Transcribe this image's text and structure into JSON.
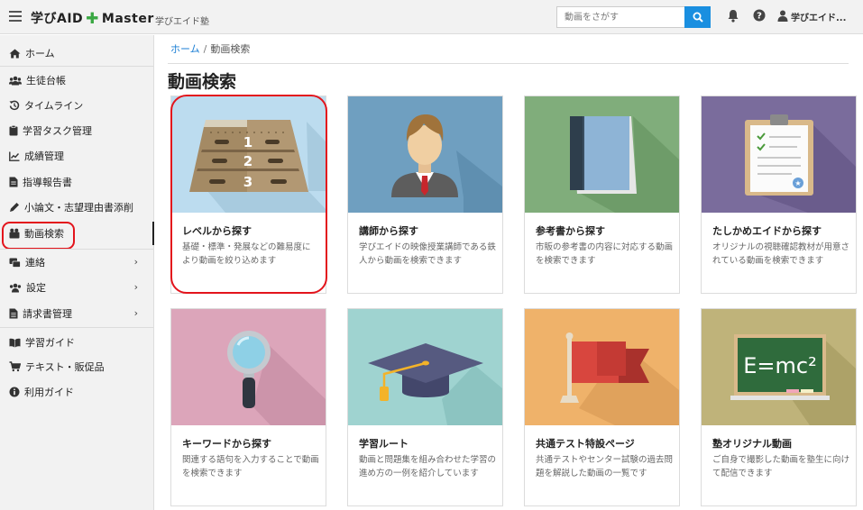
{
  "header": {
    "brand_main": "学びAID",
    "brand_tail": "Master",
    "brand_sub": "学びエイド塾",
    "search_placeholder": "動画をさがす",
    "user_name": "学びエイド..."
  },
  "sidebar": {
    "items": [
      {
        "label": "ホーム",
        "icon": "home-icon"
      },
      {
        "label": "生徒台帳",
        "icon": "users-icon"
      },
      {
        "label": "タイムライン",
        "icon": "history-icon"
      },
      {
        "label": "学習タスク管理",
        "icon": "clipboard-icon"
      },
      {
        "label": "成績管理",
        "icon": "chart-icon"
      },
      {
        "label": "指導報告書",
        "icon": "file-icon"
      },
      {
        "label": "小論文・志望理由書添削",
        "icon": "pen-icon"
      },
      {
        "label": "動画検索",
        "icon": "video-search-icon"
      },
      {
        "label": "連絡",
        "icon": "message-icon",
        "chevron": "›"
      },
      {
        "label": "設定",
        "icon": "settings-users-icon",
        "chevron": "›"
      },
      {
        "label": "請求書管理",
        "icon": "invoice-icon",
        "chevron": "›"
      },
      {
        "label": "学習ガイド",
        "icon": "book-icon"
      },
      {
        "label": "テキスト・販促品",
        "icon": "cart-icon"
      },
      {
        "label": "利用ガイド",
        "icon": "info-icon"
      }
    ]
  },
  "main": {
    "breadcrumb": {
      "home": "ホーム",
      "separator": "/",
      "current": "動画検索"
    },
    "title": "動画検索",
    "cards": [
      {
        "title": "レベルから探す",
        "desc": "基礎・標準・発展などの難易度により動画を絞り込めます",
        "image": "level-steps",
        "bg": "#bcdcef",
        "level_numbers": [
          "1",
          "2",
          "3"
        ]
      },
      {
        "title": "講師から探す",
        "desc": "学びエイドの映像授業講師である鉄人から動画を検索できます",
        "image": "teacher",
        "bg": "#6f9fc0"
      },
      {
        "title": "参考書から探す",
        "desc": "市販の参考書の内容に対応する動画を検索できます",
        "image": "book",
        "bg": "#80ad7b"
      },
      {
        "title": "たしかめエイドから探す",
        "desc": "オリジナルの視聴確認教材が用意されている動画を検索できます",
        "image": "clipboard",
        "bg": "#7a6c9c"
      },
      {
        "title": "キーワードから探す",
        "desc": "関連する語句を入力することで動画を検索できます",
        "image": "magnifier",
        "bg": "#dca5ba"
      },
      {
        "title": "学習ルート",
        "desc": "動画と問題集を組み合わせた学習の進め方の一例を紹介しています",
        "image": "grad-cap",
        "bg": "#9fd3d0"
      },
      {
        "title": "共通テスト特設ページ",
        "desc": "共通テストやセンター試験の過去問題を解説した動画の一覧です",
        "image": "flag",
        "bg": "#efb26a"
      },
      {
        "title": "塾オリジナル動画",
        "desc": "ご自身で撮影した動画を塾生に向けて配信できます",
        "image": "blackboard",
        "bg": "#bfb37a",
        "board_text": "E=mc²"
      }
    ]
  },
  "colors": {
    "accent": "#1a8fe0",
    "highlight": "#e3141c",
    "brand_cross": "#3aa843"
  }
}
